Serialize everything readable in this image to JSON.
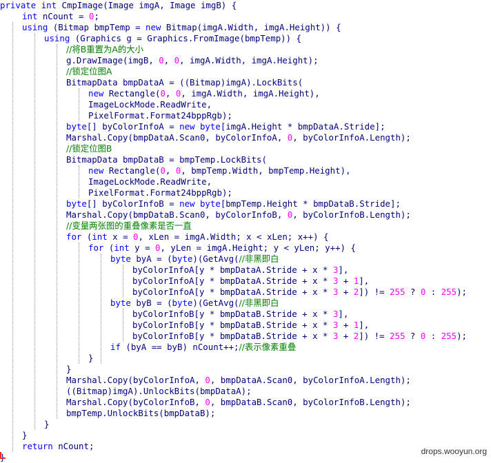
{
  "editor": {
    "language": "csharp",
    "lines": [
      [
        [
          "kw",
          "private "
        ],
        [
          "kw",
          "int "
        ],
        [
          "pl",
          "CmpImage(Image imgA, Image imgB) {"
        ]
      ],
      [
        [
          "kw",
          "int "
        ],
        [
          "pl",
          "nCount = "
        ],
        [
          "num",
          "0"
        ],
        [
          "pl",
          ";"
        ]
      ],
      [
        [
          "kw",
          "using "
        ],
        [
          "pl",
          "(Bitmap bmpTemp = "
        ],
        [
          "kw",
          "new "
        ],
        [
          "pl",
          "Bitmap(imgA.Width, imgA.Height)) {"
        ]
      ],
      [
        [
          "kw",
          "using "
        ],
        [
          "pl",
          "(Graphics g = Graphics.FromImage(bmpTemp)) {"
        ]
      ],
      [
        [
          "cm",
          "//将B重置为A的大小"
        ]
      ],
      [
        [
          "pl",
          "g.DrawImage(imgB, "
        ],
        [
          "num",
          "0"
        ],
        [
          "pl",
          ", "
        ],
        [
          "num",
          "0"
        ],
        [
          "pl",
          ", imgA.Width, imgA.Height);"
        ]
      ],
      [
        [
          "cm",
          "//锁定位图A"
        ]
      ],
      [
        [
          "pl",
          "BitmapData bmpDataA = ((Bitmap)imgA).LockBits("
        ]
      ],
      [
        [
          "kw",
          "new "
        ],
        [
          "pl",
          "Rectangle("
        ],
        [
          "num",
          "0"
        ],
        [
          "pl",
          ", "
        ],
        [
          "num",
          "0"
        ],
        [
          "pl",
          ", imgA.Width, imgA.Height),"
        ]
      ],
      [
        [
          "pl",
          "ImageLockMode.ReadWrite,"
        ]
      ],
      [
        [
          "pl",
          "PixelFormat.Format24bppRgb);"
        ]
      ],
      [
        [
          "kw",
          "byte"
        ],
        [
          "pl",
          "[] byColorInfoA = "
        ],
        [
          "kw",
          "new "
        ],
        [
          "kw",
          "byte"
        ],
        [
          "pl",
          "[imgA.Height * bmpDataA.Stride];"
        ]
      ],
      [
        [
          "pl",
          "Marshal.Copy(bmpDataA.Scan0, byColorInfoA, "
        ],
        [
          "num",
          "0"
        ],
        [
          "pl",
          ", byColorInfoA.Length);"
        ]
      ],
      [
        [
          "cm",
          "//锁定位图B"
        ]
      ],
      [
        [
          "pl",
          "BitmapData bmpDataB = bmpTemp.LockBits("
        ]
      ],
      [
        [
          "kw",
          "new "
        ],
        [
          "pl",
          "Rectangle("
        ],
        [
          "num",
          "0"
        ],
        [
          "pl",
          ", "
        ],
        [
          "num",
          "0"
        ],
        [
          "pl",
          ", bmpTemp.Width, bmpTemp.Height),"
        ]
      ],
      [
        [
          "pl",
          "ImageLockMode.ReadWrite,"
        ]
      ],
      [
        [
          "pl",
          "PixelFormat.Format24bppRgb);"
        ]
      ],
      [
        [
          "kw",
          "byte"
        ],
        [
          "pl",
          "[] byColorInfoB = "
        ],
        [
          "kw",
          "new "
        ],
        [
          "kw",
          "byte"
        ],
        [
          "pl",
          "[bmpTemp.Height * bmpDataB.Stride];"
        ]
      ],
      [
        [
          "pl",
          "Marshal.Copy(bmpDataB.Scan0, byColorInfoB, "
        ],
        [
          "num",
          "0"
        ],
        [
          "pl",
          ", byColorInfoB.Length);"
        ]
      ],
      [
        [
          "cm",
          "//变量两张图的重叠像素是否一直"
        ]
      ],
      [
        [
          "kw",
          "for "
        ],
        [
          "pl",
          "("
        ],
        [
          "kw",
          "int "
        ],
        [
          "pl",
          "x = "
        ],
        [
          "num",
          "0"
        ],
        [
          "pl",
          ", xLen = imgA.Width; x < xLen; x++) {"
        ]
      ],
      [
        [
          "kw",
          "for "
        ],
        [
          "pl",
          "("
        ],
        [
          "kw",
          "int "
        ],
        [
          "pl",
          "y = "
        ],
        [
          "num",
          "0"
        ],
        [
          "pl",
          ", yLen = imgA.Height; y < yLen; y++) {"
        ]
      ],
      [
        [
          "kw",
          "byte "
        ],
        [
          "pl",
          "byA = ("
        ],
        [
          "kw",
          "byte"
        ],
        [
          "pl",
          ")(GetAvg("
        ],
        [
          "cm",
          "//非黑即白"
        ]
      ],
      [
        [
          "pl",
          "byColorInfoA[y * bmpDataA.Stride + x * "
        ],
        [
          "num",
          "3"
        ],
        [
          "pl",
          "],"
        ]
      ],
      [
        [
          "pl",
          "byColorInfoA[y * bmpDataA.Stride + x * "
        ],
        [
          "num",
          "3"
        ],
        [
          "pl",
          " + "
        ],
        [
          "num",
          "1"
        ],
        [
          "pl",
          "],"
        ]
      ],
      [
        [
          "pl",
          "byColorInfoA[y * bmpDataA.Stride + x * "
        ],
        [
          "num",
          "3"
        ],
        [
          "pl",
          " + "
        ],
        [
          "num",
          "2"
        ],
        [
          "pl",
          "]) != "
        ],
        [
          "num",
          "255"
        ],
        [
          "pl",
          " ? "
        ],
        [
          "num",
          "0"
        ],
        [
          "pl",
          " : "
        ],
        [
          "num",
          "255"
        ],
        [
          "pl",
          ");"
        ]
      ],
      [
        [
          "kw",
          "byte "
        ],
        [
          "pl",
          "byB = ("
        ],
        [
          "kw",
          "byte"
        ],
        [
          "pl",
          ")(GetAvg("
        ],
        [
          "cm",
          "//非黑即白"
        ]
      ],
      [
        [
          "pl",
          "byColorInfoB[y * bmpDataB.Stride + x * "
        ],
        [
          "num",
          "3"
        ],
        [
          "pl",
          "],"
        ]
      ],
      [
        [
          "pl",
          "byColorInfoB[y * bmpDataB.Stride + x * "
        ],
        [
          "num",
          "3"
        ],
        [
          "pl",
          " + "
        ],
        [
          "num",
          "1"
        ],
        [
          "pl",
          "],"
        ]
      ],
      [
        [
          "pl",
          "byColorInfoB[y * bmpDataB.Stride + x * "
        ],
        [
          "num",
          "3"
        ],
        [
          "pl",
          " + "
        ],
        [
          "num",
          "2"
        ],
        [
          "pl",
          "]) != "
        ],
        [
          "num",
          "255"
        ],
        [
          "pl",
          " ? "
        ],
        [
          "num",
          "0"
        ],
        [
          "pl",
          " : "
        ],
        [
          "num",
          "255"
        ],
        [
          "pl",
          ");"
        ]
      ],
      [
        [
          "kw",
          "if "
        ],
        [
          "pl",
          "(byA == byB) nCount++;"
        ],
        [
          "cm",
          "//表示像素重叠"
        ]
      ],
      [
        [
          "pl",
          "}"
        ]
      ],
      [
        [
          "pl",
          "}"
        ]
      ],
      [
        [
          "pl",
          "Marshal.Copy(byColorInfoA, "
        ],
        [
          "num",
          "0"
        ],
        [
          "pl",
          ", bmpDataA.Scan0, byColorInfoA.Length);"
        ]
      ],
      [
        [
          "pl",
          "((Bitmap)imgA).UnlockBits(bmpDataA);"
        ]
      ],
      [
        [
          "pl",
          "Marshal.Copy(byColorInfoB, "
        ],
        [
          "num",
          "0"
        ],
        [
          "pl",
          ", bmpDataB.Scan0, byColorInfoB.Length);"
        ]
      ],
      [
        [
          "pl",
          "bmpTemp.UnlockBits(bmpDataB);"
        ]
      ],
      [
        [
          "pl",
          "}"
        ]
      ],
      [
        [
          "pl",
          "}"
        ]
      ],
      [
        [
          "kw",
          "return "
        ],
        [
          "pl",
          "nCount;"
        ]
      ],
      [
        [
          "pl",
          "}"
        ]
      ]
    ]
  },
  "colors": {
    "keyword": "#0000ff",
    "number": "#ff00ff",
    "comment": "#008000",
    "plain": "#000080",
    "guide": "#9c9c9c"
  },
  "watermark": "drops.wooyun.org"
}
